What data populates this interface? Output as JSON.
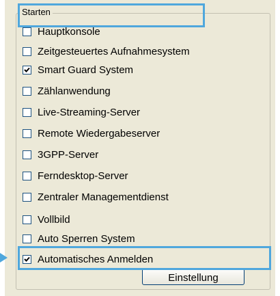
{
  "groupbox": {
    "title": "Starten"
  },
  "options": [
    {
      "label": "Hauptkonsole",
      "checked": false
    },
    {
      "label": "Zeitgesteuertes Aufnahmesystem",
      "checked": false
    },
    {
      "label": "Smart Guard System",
      "checked": true
    },
    {
      "label": "Zählanwendung",
      "checked": false
    },
    {
      "label": "Live-Streaming-Server",
      "checked": false
    },
    {
      "label": "Remote Wiedergabeserver",
      "checked": false
    },
    {
      "label": "3GPP-Server",
      "checked": false
    },
    {
      "label": "Ferndesktop-Server",
      "checked": false
    },
    {
      "label": "Zentraler Managementdienst",
      "checked": false
    },
    {
      "label": "Vollbild",
      "checked": false
    },
    {
      "label": "Auto Sperren System",
      "checked": false
    },
    {
      "label": "Automatisches Anmelden",
      "checked": true
    }
  ],
  "buttons": {
    "settings_label": "Einstellung"
  },
  "colors": {
    "highlight": "#4fa7dd",
    "dialog_bg": "#ece9d8",
    "checkbox_border": "#1c5180"
  }
}
